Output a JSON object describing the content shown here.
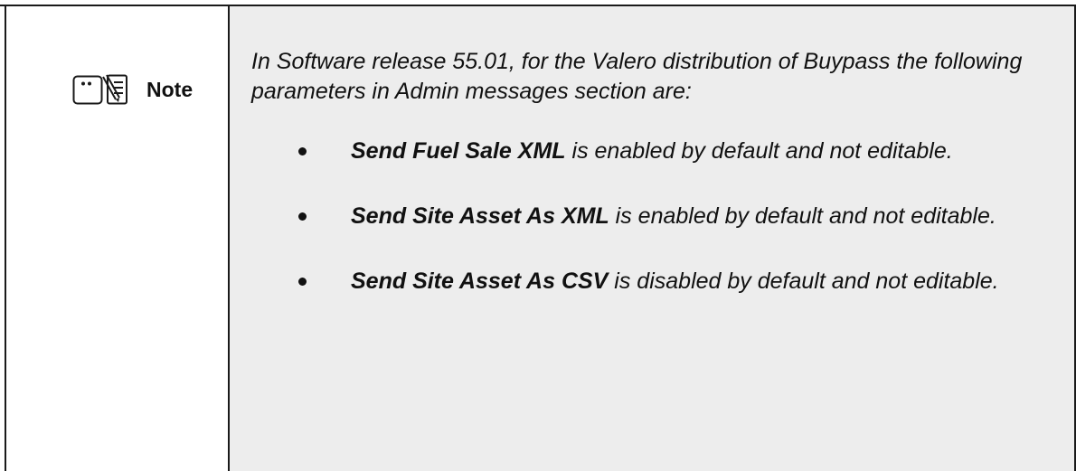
{
  "note": {
    "label": "Note",
    "icon": "note-memo-icon",
    "intro": "In Software release 55.01, for the Valero distribution of Buypass the following parameters in Admin messages section are:",
    "items": [
      {
        "parameter": "Send Fuel Sale XML",
        "description": " is enabled by default and not editable."
      },
      {
        "parameter": "Send Site Asset As XML",
        "description": " is enabled by default and not editable."
      },
      {
        "parameter": "Send Site Asset As CSV",
        "description": " is disabled by default and not editable."
      }
    ]
  }
}
